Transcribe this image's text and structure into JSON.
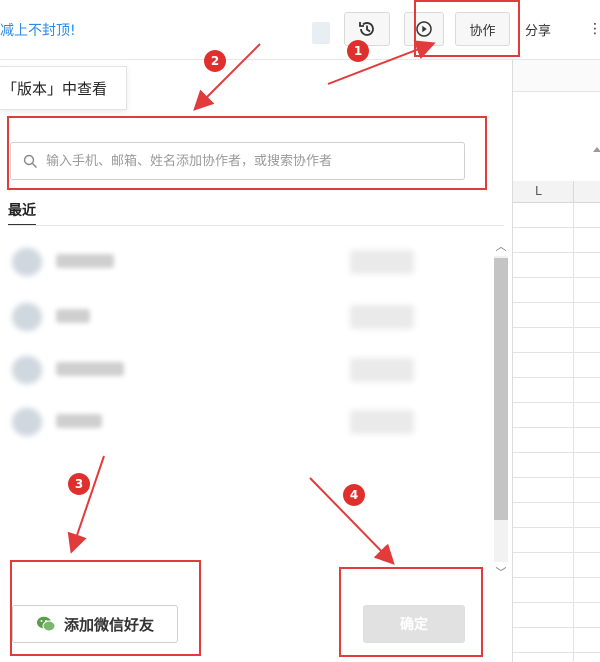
{
  "topbar": {
    "promo_text": "减上不封顶!",
    "collab_label": "协作",
    "share_label": "分享",
    "more_label": "⋮"
  },
  "tooltip": {
    "text": "「版本」中查看"
  },
  "sheet": {
    "column_letter": "L"
  },
  "dialog": {
    "search_placeholder": "输入手机、邮箱、姓名添加协作者，或搜索协作者",
    "tab_recent": "最近",
    "wechat_button": "添加微信好友",
    "confirm_button": "确定"
  },
  "annotations": {
    "badges": [
      "1",
      "2",
      "3",
      "4"
    ],
    "color": "#e23b3b"
  },
  "icons": {
    "history": "history-icon",
    "play": "play-icon",
    "search": "search-icon",
    "wechat": "wechat-icon"
  }
}
